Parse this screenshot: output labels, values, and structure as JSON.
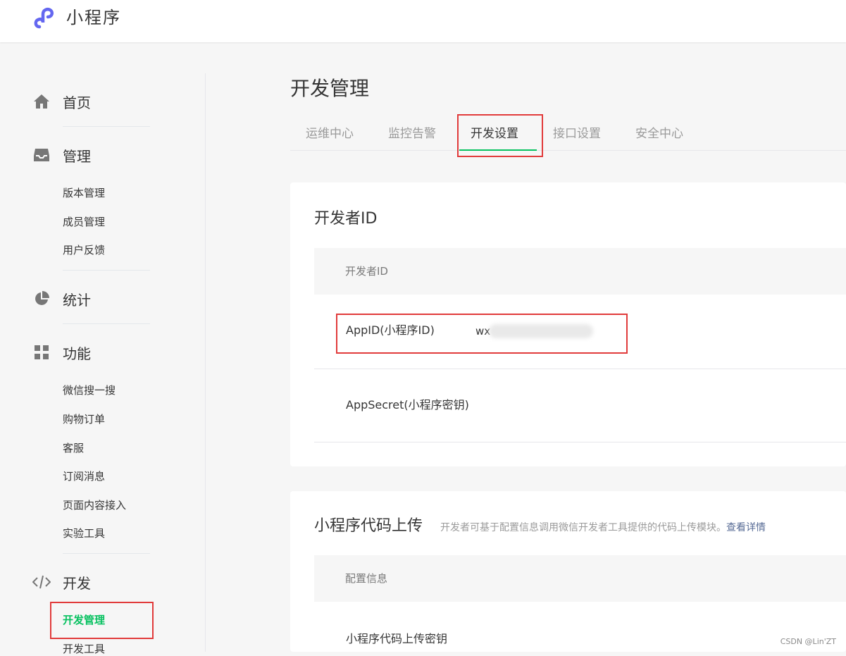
{
  "header": {
    "app_title": "小程序",
    "logo_icon": "mini-program-logo-icon",
    "brand_color": "#6467f0"
  },
  "sidebar": {
    "categories": [
      {
        "label": "首页",
        "icon": "home-icon"
      },
      {
        "label": "管理",
        "icon": "inbox-icon",
        "items": [
          "版本管理",
          "成员管理",
          "用户反馈"
        ]
      },
      {
        "label": "统计",
        "icon": "pie-chart-icon"
      },
      {
        "label": "功能",
        "icon": "grid-icon",
        "items": [
          "微信搜一搜",
          "购物订单",
          "客服",
          "订阅消息",
          "页面内容接入",
          "实验工具"
        ]
      },
      {
        "label": "开发",
        "icon": "code-icon",
        "items": [
          "开发管理",
          "开发工具"
        ]
      }
    ],
    "active_item": "开发管理",
    "active_color": "#07c160"
  },
  "main": {
    "title": "开发管理",
    "tabs": [
      {
        "label": "运维中心",
        "active": false
      },
      {
        "label": "监控告警",
        "active": false
      },
      {
        "label": "开发设置",
        "active": true
      },
      {
        "label": "接口设置",
        "active": false
      },
      {
        "label": "安全中心",
        "active": false
      }
    ],
    "developer_id": {
      "title": "开发者ID",
      "table_header": "开发者ID",
      "rows": [
        {
          "label": "AppID(小程序ID)",
          "value": "wx"
        },
        {
          "label": "AppSecret(小程序密钥)"
        }
      ]
    },
    "code_upload": {
      "title": "小程序代码上传",
      "description": "开发者可基于配置信息调用微信开发者工具提供的代码上传模块。",
      "link": "查看详情",
      "table_header": "配置信息",
      "rows": [
        {
          "label": "小程序代码上传密钥"
        }
      ]
    }
  },
  "watermark": "CSDN @Lin'ZT",
  "annotation_color": "#e13b3b"
}
